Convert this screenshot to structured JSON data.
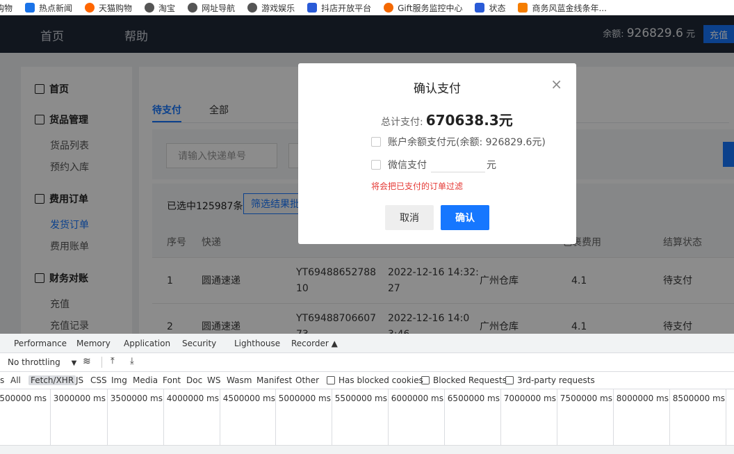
{
  "bookmarks": [
    {
      "label": "购物",
      "icon": "bookmark-icon",
      "color": "#ffffff"
    },
    {
      "label": "热点新闻",
      "icon": "news-icon",
      "color": "#1a73e8"
    },
    {
      "label": "天猫购物",
      "icon": "tmall-icon",
      "color": "#ff6600"
    },
    {
      "label": "淘宝",
      "icon": "globe-icon",
      "color": "#555555"
    },
    {
      "label": "网址导航",
      "icon": "globe-icon",
      "color": "#555555"
    },
    {
      "label": "游戏娱乐",
      "icon": "globe-icon",
      "color": "#555555"
    },
    {
      "label": "抖店开放平台",
      "icon": "doudian-icon",
      "color": "#2a5bd7"
    },
    {
      "label": "Gift服务监控中心",
      "icon": "grafana-icon",
      "color": "#f46800"
    },
    {
      "label": "状态",
      "icon": "doudian-icon",
      "color": "#2a5bd7"
    },
    {
      "label": "商务风蓝金线条年...",
      "icon": "blogger-icon",
      "color": "#f57d00"
    }
  ],
  "topnav": {
    "home": "首页",
    "help": "帮助",
    "balance_label": "余额:",
    "balance_value": "926829.6",
    "balance_unit": "元",
    "recharge": "充值"
  },
  "sidebar": {
    "groups": [
      {
        "label": "首页",
        "icon": "home-icon"
      },
      {
        "label": "货品管理",
        "icon": "goods-icon",
        "items": [
          "货品列表",
          "预约入库"
        ]
      },
      {
        "label": "费用订单",
        "icon": "order-icon",
        "items": [
          "发货订单",
          "费用账单"
        ]
      },
      {
        "label": "财务对账",
        "icon": "finance-icon",
        "items": [
          "充值",
          "充值记录"
        ]
      }
    ],
    "active_item": "发货订单"
  },
  "main": {
    "tabs": [
      "待支付",
      "全部"
    ],
    "search_placeholder": "请输入快递单号",
    "selected_text": "已选中125987条",
    "filter_button": "筛选结果批量支付",
    "columns": [
      "序号",
      "快递",
      "包裹费用",
      "结算状态"
    ],
    "rows": [
      {
        "index": "1",
        "courier": "圆通速递",
        "tracking": "YT69488652788",
        "tracking2": "10",
        "time": "2022-12-16 14:32:",
        "time2": "27",
        "warehouse": "广州仓库",
        "fee": "4.1",
        "status": "待支付"
      },
      {
        "index": "2",
        "courier": "圆通速递",
        "tracking": "YT69488706607",
        "tracking2": "73",
        "time": "2022-12-16 14:0",
        "time2": "3:46",
        "warehouse": "广州仓库",
        "fee": "4.1",
        "status": "待支付"
      }
    ]
  },
  "modal": {
    "title": "确认支付",
    "total_label": "总计支付:",
    "total_value": "670638.3元",
    "option_balance": "账户余额支付元(余额: 926829.6元)",
    "option_wechat": "微信支付",
    "wechat_unit": "元",
    "warning": "将会把已支付的订单过滤",
    "cancel": "取消",
    "confirm": "确认"
  },
  "devtools": {
    "tabs": [
      "Performance",
      "Memory",
      "Application",
      "Security",
      "Lighthouse",
      "Recorder"
    ],
    "throttling": "No throttling",
    "filters": [
      "s",
      "All",
      "Fetch/XHR",
      "JS",
      "CSS",
      "Img",
      "Media",
      "Font",
      "Doc",
      "WS",
      "Wasm",
      "Manifest",
      "Other"
    ],
    "checkboxes": [
      "Has blocked cookies",
      "Blocked Requests",
      "3rd-party requests"
    ],
    "timeline_ticks": [
      "2500000 ms",
      "3000000 ms",
      "3500000 ms",
      "4000000 ms",
      "4500000 ms",
      "5000000 ms",
      "5500000 ms",
      "6000000 ms",
      "6500000 ms",
      "7000000 ms",
      "7500000 ms",
      "8000000 ms",
      "8500000 ms"
    ]
  }
}
